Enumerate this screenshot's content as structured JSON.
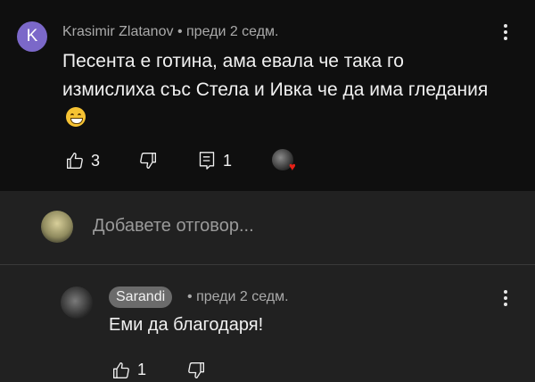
{
  "comment": {
    "avatar_letter": "K",
    "author": "Krasimir Zlatanov",
    "separator": "•",
    "time": "преди 2 седм.",
    "text": "Песента е готина, ама евала че така го измислиха със Стела и Ивка че да има гледания",
    "likes": "3",
    "replies": "1",
    "creator_heart": "♥"
  },
  "reply_box": {
    "placeholder": "Добавете отговор..."
  },
  "reply": {
    "author": "Sarandi",
    "separator": "•",
    "time": "преди 2 седм.",
    "text": "Еми да благодаря!",
    "likes": "1"
  },
  "colors": {
    "background_top": "#0f0f0f",
    "background_reply": "#212121",
    "avatar_k": "#7b68c9",
    "heart": "#e62117",
    "author_badge": "#6b6b6b"
  }
}
